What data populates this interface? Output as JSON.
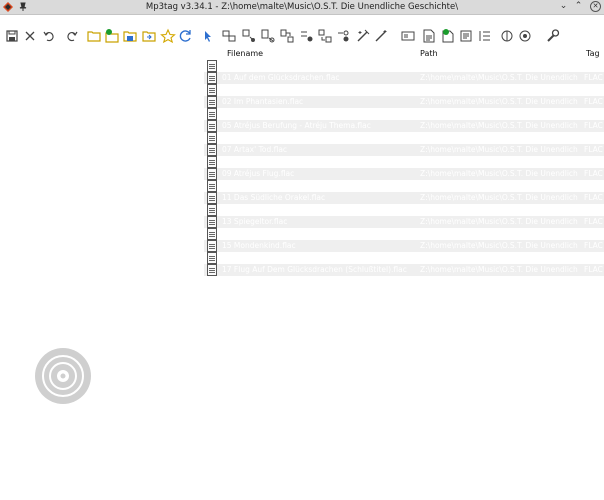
{
  "window": {
    "title": "Mp3tag v3.34.1 - Z:\\home\\malte\\Music\\O.S.T. Die Unendliche Geschichte\\"
  },
  "columns": {
    "filename": "Filename",
    "path": "Path",
    "tag": "Tag"
  },
  "rows": [
    {
      "filename": "",
      "path": "",
      "tag": ""
    },
    {
      "filename": "01 Auf dem Glücksdrachen.flac",
      "path": "Z:\\home\\malte\\Music\\O.S.T. Die Unendlich...",
      "tag": "FLAC",
      "shaded": true
    },
    {
      "filename": "",
      "path": "",
      "tag": ""
    },
    {
      "filename": "02 Im Phantasien.flac",
      "path": "Z:\\home\\malte\\Music\\O.S.T. Die Unendlich...",
      "tag": "FLAC",
      "shaded": true
    },
    {
      "filename": "",
      "path": "",
      "tag": ""
    },
    {
      "filename": "05 Atréjus Berufung - Atréju Thema.flac",
      "path": "Z:\\home\\malte\\Music\\O.S.T. Die Unendlich...",
      "tag": "FLAC",
      "shaded": true
    },
    {
      "filename": "",
      "path": "",
      "tag": ""
    },
    {
      "filename": "07 Artax' Tod.flac",
      "path": "Z:\\home\\malte\\Music\\O.S.T. Die Unendlich...",
      "tag": "FLAC",
      "shaded": true
    },
    {
      "filename": "",
      "path": "",
      "tag": ""
    },
    {
      "filename": "09 Atréjus Flug.flac",
      "path": "Z:\\home\\malte\\Music\\O.S.T. Die Unendlich...",
      "tag": "FLAC",
      "shaded": true
    },
    {
      "filename": "",
      "path": "",
      "tag": ""
    },
    {
      "filename": "11 Das Südliche Orakel.flac",
      "path": "Z:\\home\\malte\\Music\\O.S.T. Die Unendlich...",
      "tag": "FLAC",
      "shaded": true
    },
    {
      "filename": "",
      "path": "",
      "tag": ""
    },
    {
      "filename": "13 Spiegeltor.flac",
      "path": "Z:\\home\\malte\\Music\\O.S.T. Die Unendlich...",
      "tag": "FLAC",
      "shaded": true
    },
    {
      "filename": "",
      "path": "",
      "tag": ""
    },
    {
      "filename": "15 Mondenkind.flac",
      "path": "Z:\\home\\malte\\Music\\O.S.T. Die Unendlich...",
      "tag": "FLAC",
      "shaded": true
    },
    {
      "filename": "",
      "path": "",
      "tag": ""
    },
    {
      "filename": "17 Flug Auf Dem Glücksdrachen (Schlußtitel).flac",
      "path": "Z:\\home\\malte\\Music\\O.S.T. Die Unendlich...",
      "tag": "FLAC",
      "shaded": true
    }
  ],
  "toolbar_icons": [
    "save-icon",
    "remove-icon",
    "undo-icon",
    "redo-icon",
    "change-directory-icon",
    "add-directory-icon",
    "change-directory-alt-icon",
    "move-icon",
    "favorites-star-icon",
    "refresh-icon",
    "select-icon",
    "tag-source-icon",
    "filename-to-tag-icon",
    "tag-to-filename-icon",
    "convert-icon",
    "actions-icon",
    "auto-numbering-icon",
    "export-icon",
    "playlist-icon",
    "extended-tags-icon",
    "text-file-icon",
    "numbering-icon",
    "cover-art-icon",
    "tag-sources-web-icon",
    "options-wrench-icon"
  ]
}
